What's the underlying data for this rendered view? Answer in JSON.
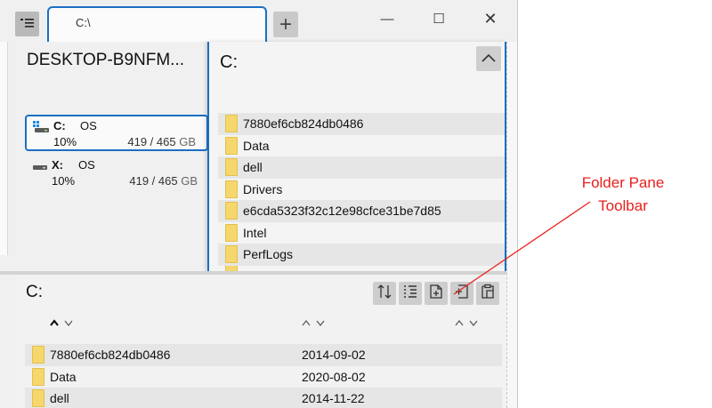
{
  "window": {
    "tab_title": "C:\\",
    "new_tab_symbol": "+",
    "minimize_symbol": "—",
    "maximize_symbol": "☐",
    "close_symbol": "✕",
    "menu_icon": "menu-icon"
  },
  "drives_pane": {
    "computer_name": "DESKTOP-B9NFM...",
    "drives": [
      {
        "letter": "C:",
        "label": "OS",
        "used_percent": "10%",
        "capacity": "419 / 465",
        "unit": "GB",
        "selected": true,
        "icon": "windows-drive-icon"
      },
      {
        "letter": "X:",
        "label": "OS",
        "used_percent": "10%",
        "capacity": "419 / 465",
        "unit": "GB",
        "selected": false,
        "icon": "drive-icon"
      }
    ]
  },
  "folder_pane_top": {
    "path": "C:",
    "up_icon": "chevron-up-icon",
    "items": [
      "7880ef6cb824db0486",
      "Data",
      "dell",
      "Drivers",
      "e6cda5323f32c12e98cfce31be7d85",
      "Intel",
      "PerfLogs"
    ]
  },
  "folder_pane_bottom": {
    "path": "C:",
    "toolbar": [
      "sort-icon",
      "details-list-icon",
      "new-file-icon",
      "new-folder-icon",
      "paste-icon"
    ],
    "sort_arrows": "⌃⌄",
    "rows": [
      {
        "name": "7880ef6cb824db0486",
        "date": "2014-09-02"
      },
      {
        "name": "Data",
        "date": "2020-08-02"
      },
      {
        "name": "dell",
        "date": "2014-11-22"
      }
    ]
  },
  "annotation": {
    "line1": "Folder Pane",
    "line2": "Toolbar",
    "color": "#e8211f"
  },
  "colors": {
    "accent": "#1b6fc4",
    "folder": "#f5d76e"
  }
}
